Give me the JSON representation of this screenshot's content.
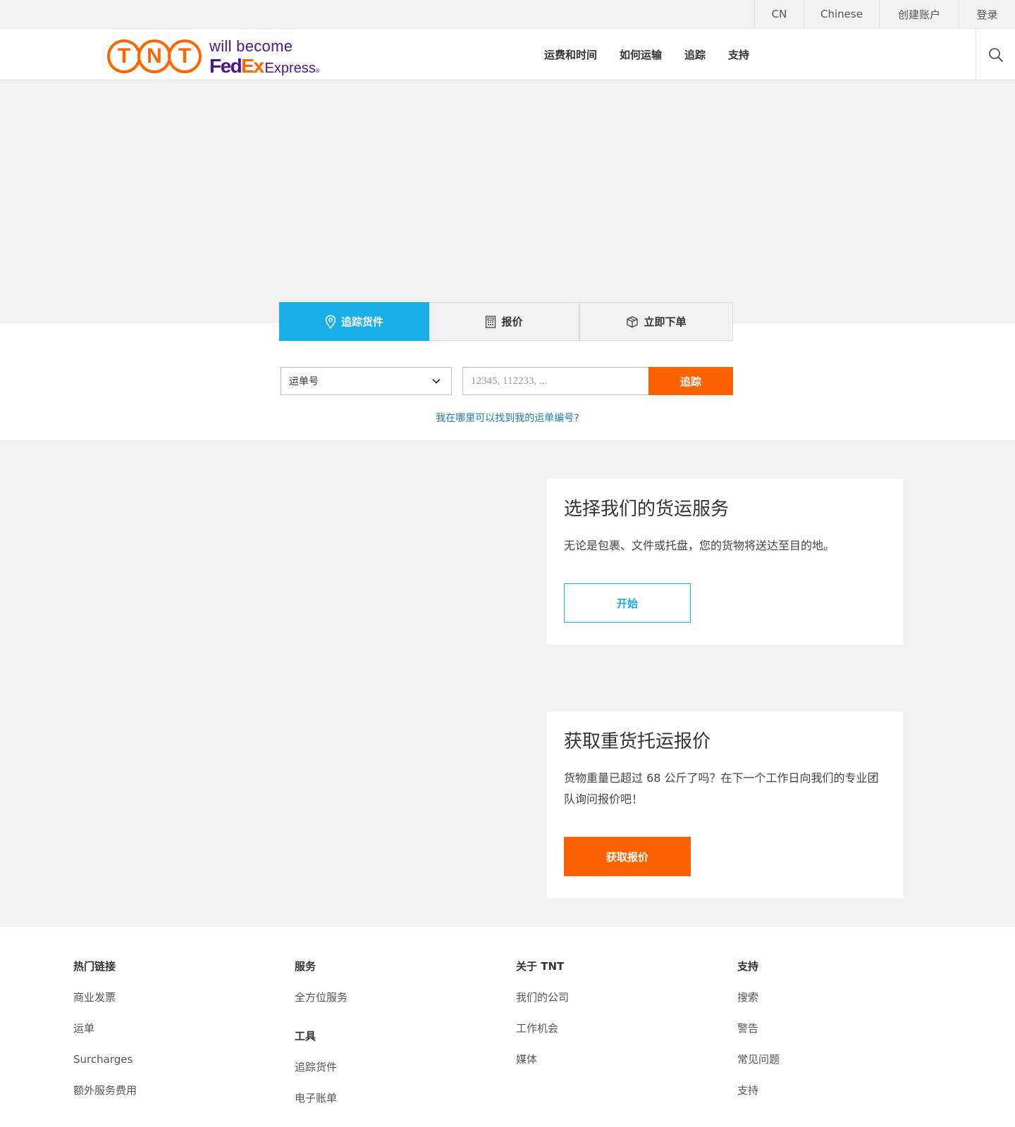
{
  "topbar": {
    "country": "CN",
    "language": "Chinese",
    "create_account": "创建账户",
    "login": "登录"
  },
  "logo": {
    "tnt_letters": [
      "T",
      "N",
      "T"
    ],
    "will_become": "will become",
    "fed": "Fed",
    "ex": "Ex",
    "express": "Express",
    "reg": "®",
    "colors": {
      "tnt_orange": "#ff6600",
      "fedex_purple": "#4d148c"
    }
  },
  "nav": {
    "items": [
      "运费和时间",
      "如何运输",
      "追踪",
      "支持"
    ],
    "search_icon": "search-icon"
  },
  "tabs": [
    {
      "label": "追踪货件",
      "icon": "location-pin-icon",
      "active": true
    },
    {
      "label": "报价",
      "icon": "calculator-icon",
      "active": false
    },
    {
      "label": "立即下单",
      "icon": "box-icon",
      "active": false
    }
  ],
  "tracking": {
    "select_value": "运单号",
    "input_placeholder": "12345, 112233, ...",
    "button": "追踪",
    "help_link": "我在哪里可以找到我的运单编号?"
  },
  "cards": [
    {
      "title": "选择我们的货运服务",
      "text": "无论是包裹、文件或托盘，您的货物将送达至目的地。",
      "button": "开始"
    },
    {
      "title": "获取重货托运报价",
      "text": "货物重量已超过 68 公斤了吗？在下一个工作日向我们的专业团队询问报价吧！",
      "button": "获取报价"
    }
  ],
  "footer": {
    "popular": {
      "heading": "热门链接",
      "links": [
        "商业发票",
        "运单",
        "Surcharges",
        "额外服务费用"
      ]
    },
    "services": {
      "heading": "服务",
      "links": [
        "全方位服务"
      ]
    },
    "tools": {
      "heading": "工具",
      "links": [
        "追踪货件",
        "电子账单"
      ]
    },
    "about": {
      "heading": "关于 TNT",
      "links": [
        "我们的公司",
        "工作机会",
        "媒体"
      ]
    },
    "support": {
      "heading": "支持",
      "links": [
        "搜索",
        "警告",
        "常见问题",
        "支持"
      ]
    }
  },
  "colors": {
    "accent_blue": "#1aaee8",
    "accent_orange": "#ff6200",
    "link_blue": "#1f7fb0",
    "background_grey": "#f2f2f2"
  }
}
